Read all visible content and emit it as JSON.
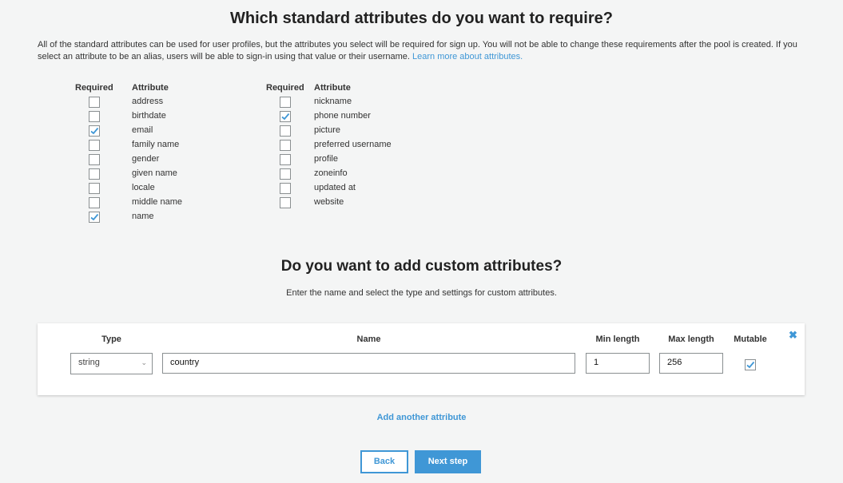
{
  "title": "Which standard attributes do you want to require?",
  "description": "All of the standard attributes can be used for user profiles, but the attributes you select will be required for sign up. You will not be able to change these requirements after the pool is created. If you select an attribute to be an alias, users will be able to sign-in using that value or their username.",
  "learn_more": "Learn more about attributes.",
  "headers": {
    "required": "Required",
    "attribute": "Attribute"
  },
  "left_attributes": [
    {
      "name": "address",
      "required": false
    },
    {
      "name": "birthdate",
      "required": false
    },
    {
      "name": "email",
      "required": true
    },
    {
      "name": "family name",
      "required": false
    },
    {
      "name": "gender",
      "required": false
    },
    {
      "name": "given name",
      "required": false
    },
    {
      "name": "locale",
      "required": false
    },
    {
      "name": "middle name",
      "required": false
    },
    {
      "name": "name",
      "required": true
    }
  ],
  "right_attributes": [
    {
      "name": "nickname",
      "required": false
    },
    {
      "name": "phone number",
      "required": true
    },
    {
      "name": "picture",
      "required": false
    },
    {
      "name": "preferred username",
      "required": false
    },
    {
      "name": "profile",
      "required": false
    },
    {
      "name": "zoneinfo",
      "required": false
    },
    {
      "name": "updated at",
      "required": false
    },
    {
      "name": "website",
      "required": false
    }
  ],
  "custom_title": "Do you want to add custom attributes?",
  "custom_subtitle": "Enter the name and select the type and settings for custom attributes.",
  "custom": {
    "headers": {
      "type": "Type",
      "name": "Name",
      "min": "Min length",
      "max": "Max length",
      "mutable": "Mutable"
    },
    "type": "string",
    "name": "country",
    "min": "1",
    "max": "256",
    "mutable": true
  },
  "add_another": "Add another attribute",
  "back": "Back",
  "next": "Next step",
  "colors": {
    "accent": "#3f97d6",
    "background": "#f4f5f5"
  }
}
